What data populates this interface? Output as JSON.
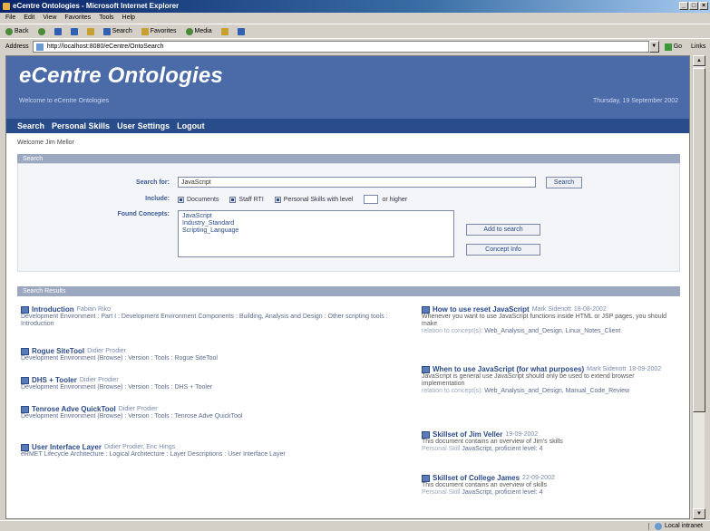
{
  "window": {
    "title": "eCentre Ontologies - Microsoft Internet Explorer",
    "menu": [
      "File",
      "Edit",
      "View",
      "Favorites",
      "Tools",
      "Help"
    ],
    "toolbar": [
      "Back",
      "Search",
      "Favorites",
      "Media"
    ],
    "address_label": "Address",
    "address_value": "http://localhost:8080/eCentre/OntoSearch",
    "go_label": "Go",
    "links_label": "Links",
    "status_zone": "Local intranet"
  },
  "app": {
    "brand": "eCentre Ontologies",
    "tagline": "Welcome to eCentre Ontologies",
    "date": "Thursday, 19 September 2002",
    "nav": [
      "Search",
      "Personal Skills",
      "User Settings",
      "Logout"
    ],
    "welcome": "Welcome Jim Mellor"
  },
  "search": {
    "header": "Search",
    "search_for_label": "Search for:",
    "search_for_value": "JavaScript",
    "search_button": "Search",
    "include_label": "Include:",
    "include_options": [
      {
        "label": "Documents",
        "checked": true
      },
      {
        "label": "Staff RTI",
        "checked": true
      },
      {
        "label": "Personal Skills with level",
        "checked": true
      }
    ],
    "or_higher": "or higher",
    "found_concepts_label": "Found Concepts:",
    "found_concepts": [
      "JavaScript",
      "Industry_Standard",
      "Scripting_Language"
    ],
    "add_to_search_button": "Add to search",
    "concept_info_button": "Concept Info"
  },
  "results": {
    "header": "Search Results",
    "left": [
      {
        "title": "Introduction",
        "author": "Fabian Riko",
        "path": "Development Environment : Part I : Development Environment Components : Building, Analysis and Design : Other scripting tools : Introduction"
      },
      {
        "title": "Rogue SiteTool",
        "author": "Didier Prodier",
        "path": "Development Environment (Browse) : Version : Tools : Rogue SiteTool"
      },
      {
        "title": "DHS + Tooler",
        "author": "Didier Prodier",
        "path": "Development Environment (Browse) : Version : Tools : DHS + Tooler"
      },
      {
        "title": "Tenrose Adve QuickTool",
        "author": "Didier Prodier",
        "path": "Development Environment (Browse) : Version : Tools : Tenrose Adve QuickTool"
      },
      {
        "title": "User Interface Layer",
        "author": "Didier Prodier, Eric Hings",
        "path": "eRMET Lifecycle Architecture : Logical Architecture : Layer Descriptions : User Interface Layer"
      }
    ],
    "right": [
      {
        "title": "How to use reset JavaScript",
        "author": "Mark Sidenott",
        "date": "18-08-2002",
        "desc": "Whenever you want to use JavaScript functions inside HTML or JSP pages, you should make",
        "concepts_label": "relation to concept(s):",
        "concepts": "Web_Analysis_and_Design, Linux_Notes_Client"
      },
      {
        "title": "When to use JavaScript (for what purposes)",
        "author": "Mark Sidenott",
        "date": "18-09-2002",
        "desc": "JavaScript is general use JavaScript should only be used to extend browser implementation",
        "concepts_label": "relation to concept(s):",
        "concepts": "Web_Analysis_and_Design, Manual_Code_Review"
      },
      {
        "title": "Skillset of Jim Veller",
        "date": "19-09-2002",
        "desc": "This document contains an overview of Jim's skills",
        "concepts_label": "Personal Skill",
        "concepts": "JavaScript, proficient level: 4"
      },
      {
        "title": "Skillset of College James",
        "date": "22-09-2002",
        "desc": "This document contains an overview of skills",
        "concepts_label": "Personal Skill",
        "concepts": "JavaScript, proficient level: 4"
      }
    ]
  }
}
